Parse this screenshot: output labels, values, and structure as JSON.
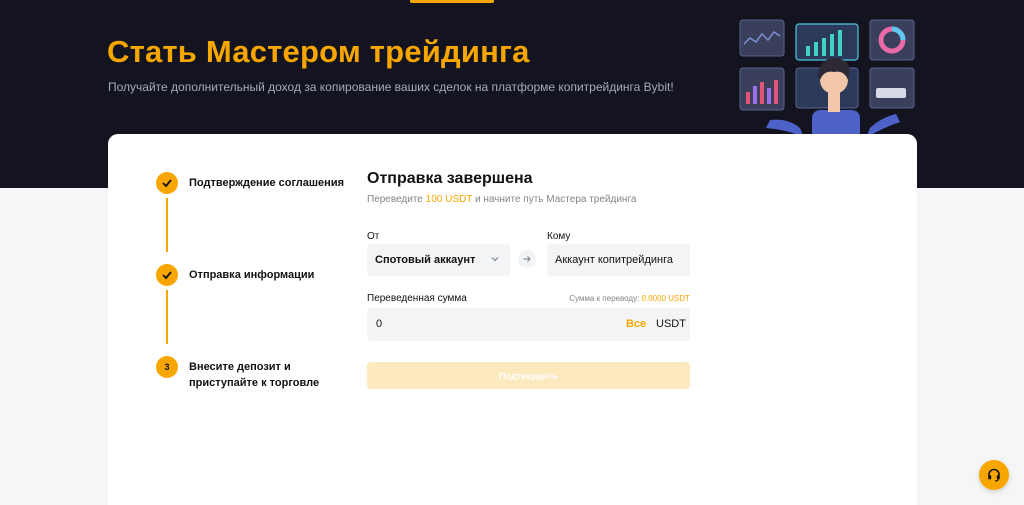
{
  "hero": {
    "title": "Стать Мастером трейдинга",
    "subtitle": "Получайте дополнительный доход за копирование ваших сделок на платформе копитрейдинга Bybit!"
  },
  "steps": [
    {
      "label_lines": [
        "Подтверждение соглашения"
      ],
      "status": "done",
      "icon": "check-icon"
    },
    {
      "label_lines": [
        "Отправка информации"
      ],
      "status": "done",
      "icon": "check-icon"
    },
    {
      "label_lines": [
        "Внесите депозит и",
        "приступайте к торговле"
      ],
      "status": "current",
      "number": "3"
    }
  ],
  "form": {
    "title": "Отправка завершена",
    "subtitle_pre": "Переведите",
    "subtitle_amount": "100 USDT",
    "subtitle_post": "и начните путь Мастера трейдинга",
    "from_label": "От",
    "from_value": "Спотовый аккаунт",
    "to_label": "Кому",
    "to_value": "Аккаунт копитрейдинга",
    "amount_label": "Переведенная сумма",
    "transferable_label": "Сумма к переводу:",
    "transferable_value": "0.0000 USDT",
    "amount_value": "0",
    "all_label": "Все",
    "unit": "USDT",
    "confirm_label": "Подтвердить"
  },
  "colors": {
    "accent": "#f7a600",
    "hero_bg": "#13141f",
    "disabled_button": "#fde9be"
  },
  "icons": {
    "swap": "arrow-right-icon",
    "dropdown": "chevron-down-icon",
    "support": "headset-icon"
  }
}
